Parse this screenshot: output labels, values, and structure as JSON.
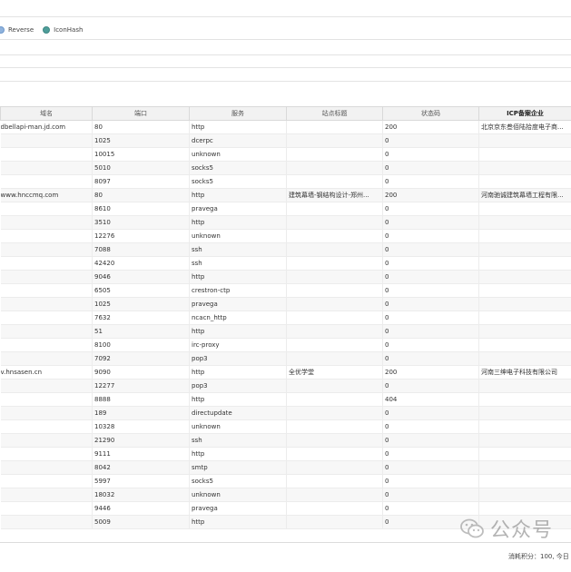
{
  "search_options": {
    "items": [
      {
        "label": "Reverse",
        "color": "#8fb3dd"
      },
      {
        "label": "IconHash",
        "color": "#4e9e9a"
      }
    ]
  },
  "table": {
    "columns": [
      "域名",
      "端口",
      "服务",
      "站点标题",
      "状态码",
      "ICP备案企业"
    ],
    "rows": [
      [
        "dbellapi-man.jd.com",
        "80",
        "http",
        "",
        "200",
        "北京京东叁佰陆拾度电子商..."
      ],
      [
        "",
        "1025",
        "dcerpc",
        "",
        "0",
        ""
      ],
      [
        "",
        "10015",
        "unknown",
        "",
        "0",
        ""
      ],
      [
        "",
        "5010",
        "socks5",
        "",
        "0",
        ""
      ],
      [
        "",
        "8097",
        "socks5",
        "",
        "0",
        ""
      ],
      [
        "www.hnccmq.com",
        "80",
        "http",
        "建筑幕墙-钢结构设计-郑州...",
        "200",
        "河南驰诚建筑幕墙工程有限..."
      ],
      [
        "",
        "8610",
        "pravega",
        "",
        "0",
        ""
      ],
      [
        "",
        "3510",
        "http",
        "",
        "0",
        ""
      ],
      [
        "",
        "12276",
        "unknown",
        "",
        "0",
        ""
      ],
      [
        "",
        "7088",
        "ssh",
        "",
        "0",
        ""
      ],
      [
        "",
        "42420",
        "ssh",
        "",
        "0",
        ""
      ],
      [
        "",
        "9046",
        "http",
        "",
        "0",
        ""
      ],
      [
        "",
        "6505",
        "crestron-ctp",
        "",
        "0",
        ""
      ],
      [
        "",
        "1025",
        "pravega",
        "",
        "0",
        ""
      ],
      [
        "",
        "7632",
        "ncacn_http",
        "",
        "0",
        ""
      ],
      [
        "",
        "51",
        "http",
        "",
        "0",
        ""
      ],
      [
        "",
        "8100",
        "irc-proxy",
        "",
        "0",
        ""
      ],
      [
        "",
        "7092",
        "pop3",
        "",
        "0",
        ""
      ],
      [
        "v.hnsasen.cn",
        "9090",
        "http",
        "全优学堂",
        "200",
        "河南三绅电子科技有限公司"
      ],
      [
        "",
        "12277",
        "pop3",
        "",
        "0",
        ""
      ],
      [
        "",
        "8888",
        "http",
        "",
        "404",
        ""
      ],
      [
        "",
        "189",
        "directupdate",
        "",
        "0",
        ""
      ],
      [
        "",
        "10328",
        "unknown",
        "",
        "0",
        ""
      ],
      [
        "",
        "21290",
        "ssh",
        "",
        "0",
        ""
      ],
      [
        "",
        "9111",
        "http",
        "",
        "0",
        ""
      ],
      [
        "",
        "8042",
        "smtp",
        "",
        "0",
        ""
      ],
      [
        "",
        "5997",
        "socks5",
        "",
        "0",
        ""
      ],
      [
        "",
        "18032",
        "unknown",
        "",
        "0",
        ""
      ],
      [
        "",
        "9446",
        "pravega",
        "",
        "0",
        ""
      ],
      [
        "",
        "5009",
        "http",
        "",
        "0",
        ""
      ]
    ]
  },
  "footer": {
    "credits_text": "消耗积分：100, 今日"
  },
  "watermark": {
    "text": "公众号"
  }
}
